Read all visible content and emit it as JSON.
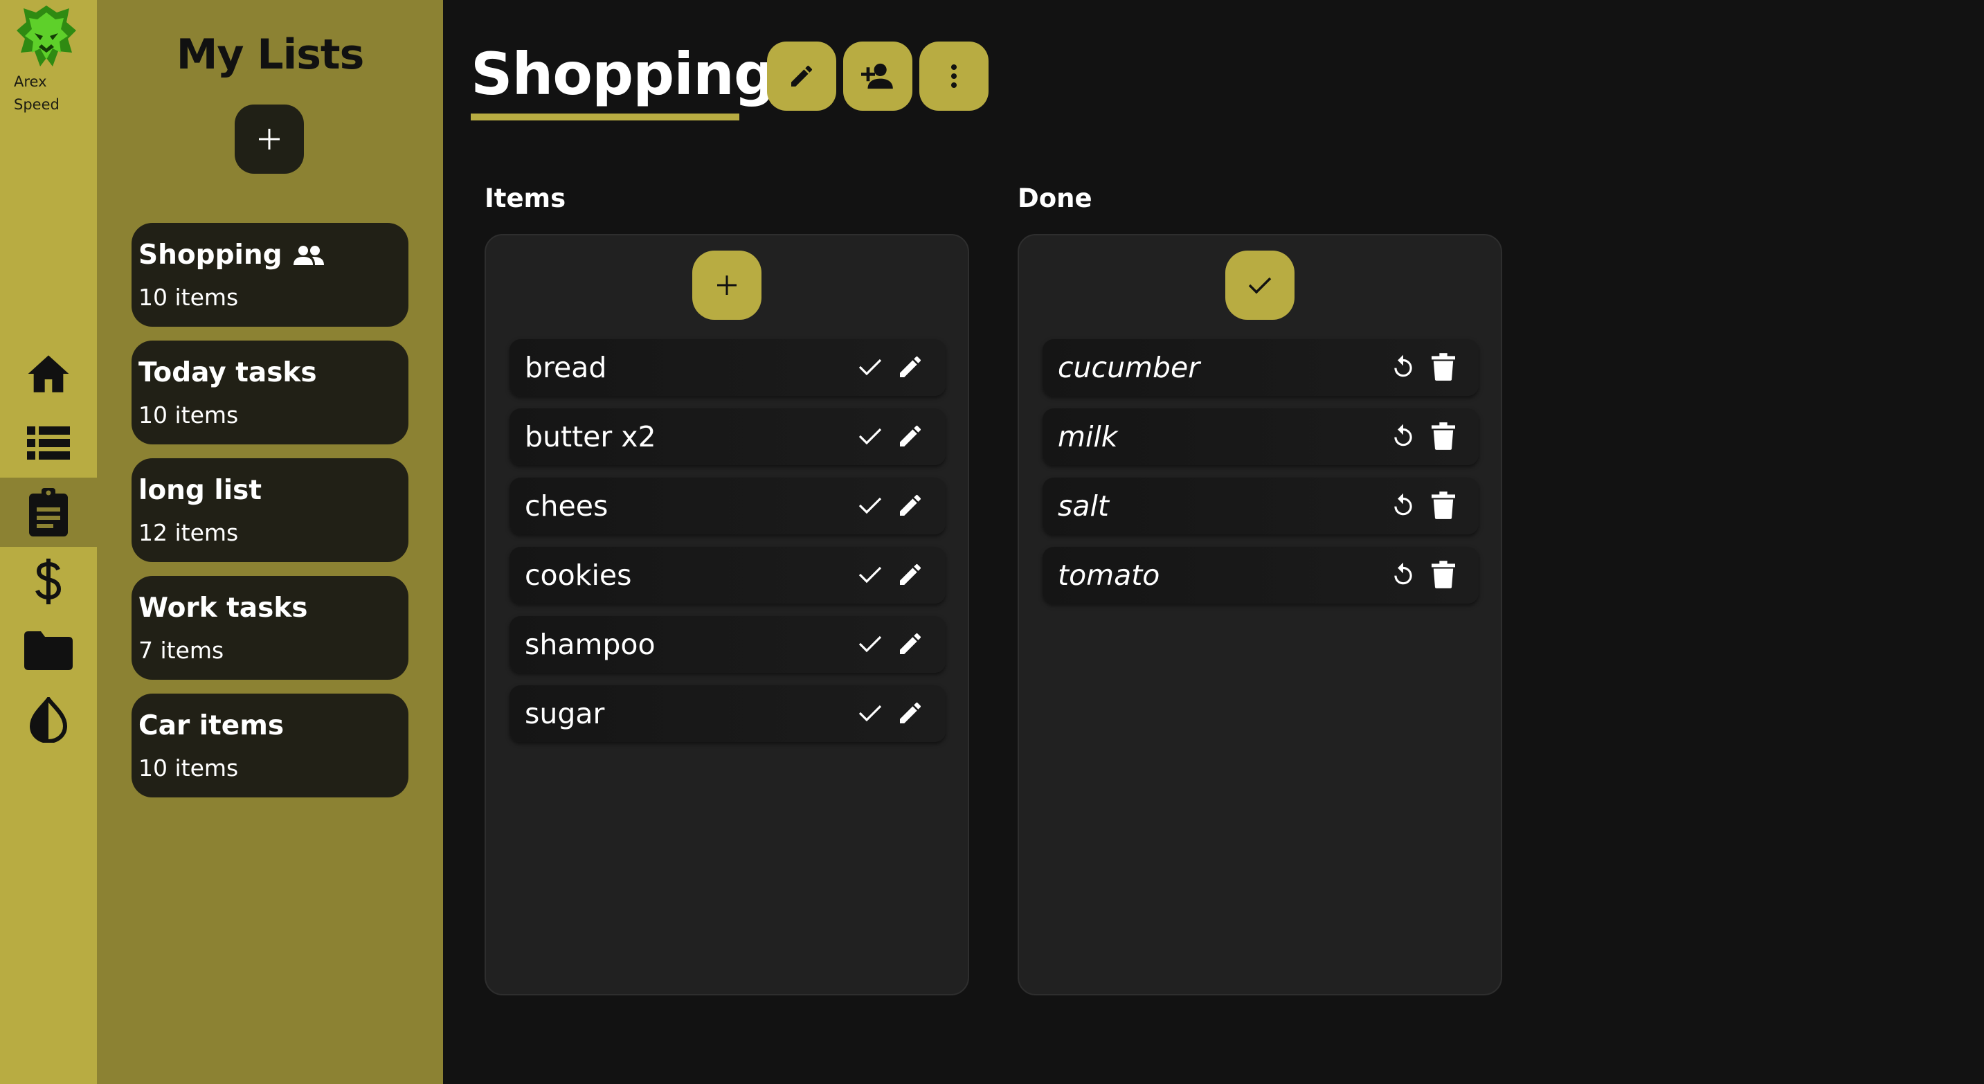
{
  "user": {
    "name": "Arex Speed"
  },
  "nav": {
    "items": [
      {
        "name": "home",
        "icon": "home-icon"
      },
      {
        "name": "lists",
        "icon": "list-icon"
      },
      {
        "name": "tasks",
        "icon": "clipboard-icon",
        "active": true
      },
      {
        "name": "money",
        "icon": "dollar-icon"
      },
      {
        "name": "files",
        "icon": "folder-icon"
      },
      {
        "name": "theme",
        "icon": "contrast-icon"
      }
    ]
  },
  "lists_panel": {
    "title": "My Lists",
    "lists": [
      {
        "name": "Shopping",
        "count": "10 items",
        "shared": true
      },
      {
        "name": "Today tasks",
        "count": "10 items"
      },
      {
        "name": "long list",
        "count": "12 items"
      },
      {
        "name": "Work tasks",
        "count": "7 items"
      },
      {
        "name": "Car items",
        "count": "10 items"
      }
    ]
  },
  "header": {
    "title": "Shopping"
  },
  "items_column": {
    "title": "Items",
    "items": [
      "bread",
      "butter x2",
      "chees",
      "cookies",
      "shampoo",
      "sugar"
    ]
  },
  "done_column": {
    "title": "Done",
    "items": [
      "cucumber",
      "milk",
      "salt",
      "tomato"
    ]
  },
  "colors": {
    "accent": "#b8ac42",
    "panel": "#8c8233",
    "background": "#121212",
    "card": "#212016"
  }
}
